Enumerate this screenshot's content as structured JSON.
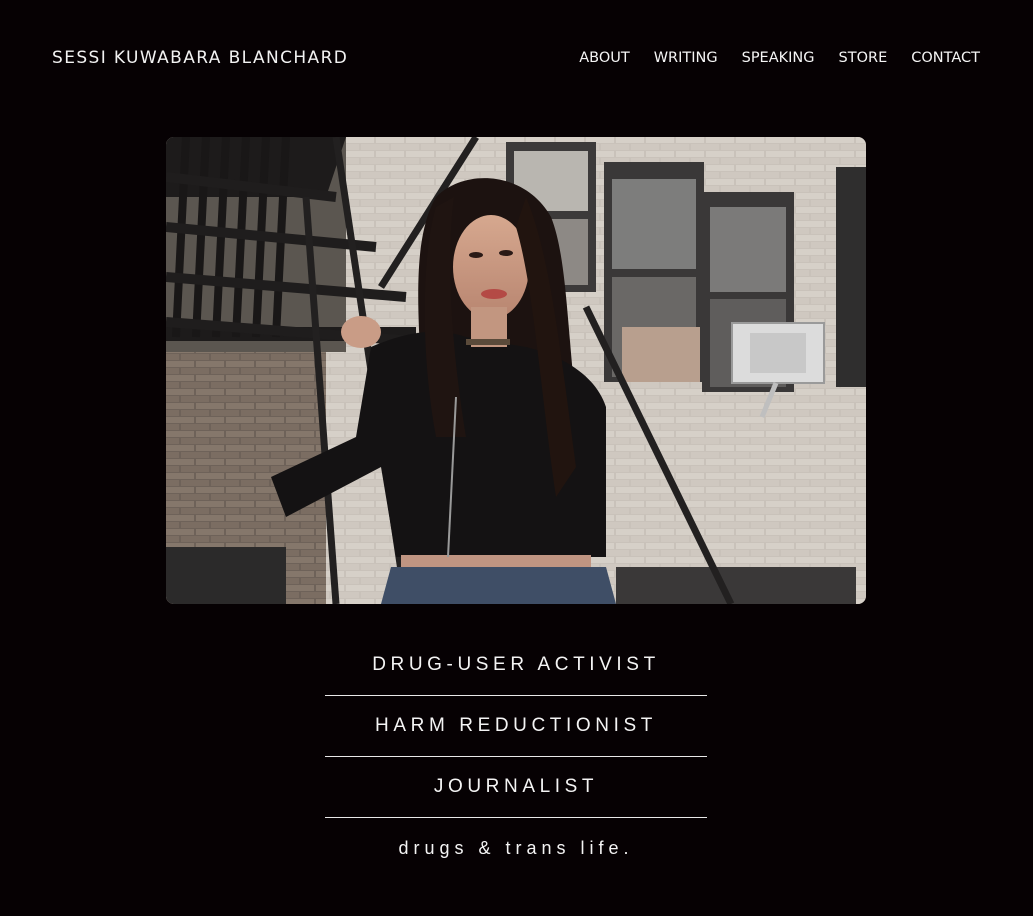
{
  "header": {
    "site_title": "SESSI KUWABARA BLANCHARD",
    "nav": [
      {
        "label": "ABOUT"
      },
      {
        "label": "WRITING"
      },
      {
        "label": "SPEAKING"
      },
      {
        "label": "STORE"
      },
      {
        "label": "CONTACT"
      }
    ]
  },
  "hero": {
    "alt": "Portrait of a woman with long dark hair in a black top and jeans leaning on a fire escape in front of a brick building"
  },
  "taglines": [
    {
      "text": "DRUG-USER ACTIVIST"
    },
    {
      "text": "HARM REDUCTIONIST"
    },
    {
      "text": "JOURNALIST"
    },
    {
      "text": "drugs & trans life."
    }
  ],
  "colors": {
    "background": "#060103",
    "text": "#ffffff",
    "divider": "#e8e8e8"
  }
}
